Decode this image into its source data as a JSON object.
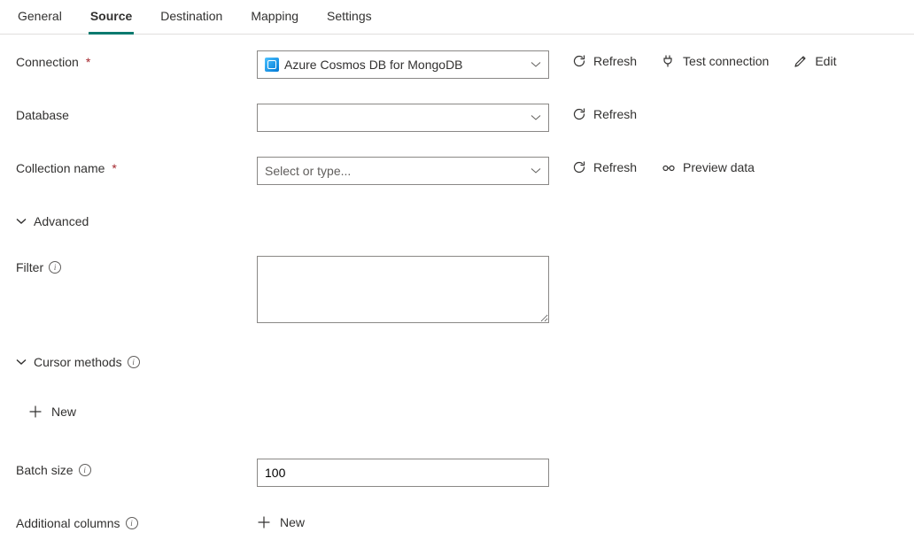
{
  "tabs": {
    "general": "General",
    "source": "Source",
    "destination": "Destination",
    "mapping": "Mapping",
    "settings": "Settings",
    "active": "source"
  },
  "labels": {
    "connection": "Connection",
    "database": "Database",
    "collection": "Collection name",
    "advanced": "Advanced",
    "filter": "Filter",
    "cursor": "Cursor methods",
    "batch": "Batch size",
    "addcols": "Additional columns"
  },
  "fields": {
    "connection_value": "Azure Cosmos DB for MongoDB",
    "database_value": "",
    "collection_placeholder": "Select or type...",
    "collection_value": "",
    "filter_value": "",
    "batch_value": "100"
  },
  "actions": {
    "refresh": "Refresh",
    "test": "Test connection",
    "edit": "Edit",
    "preview": "Preview data",
    "new": "New"
  }
}
